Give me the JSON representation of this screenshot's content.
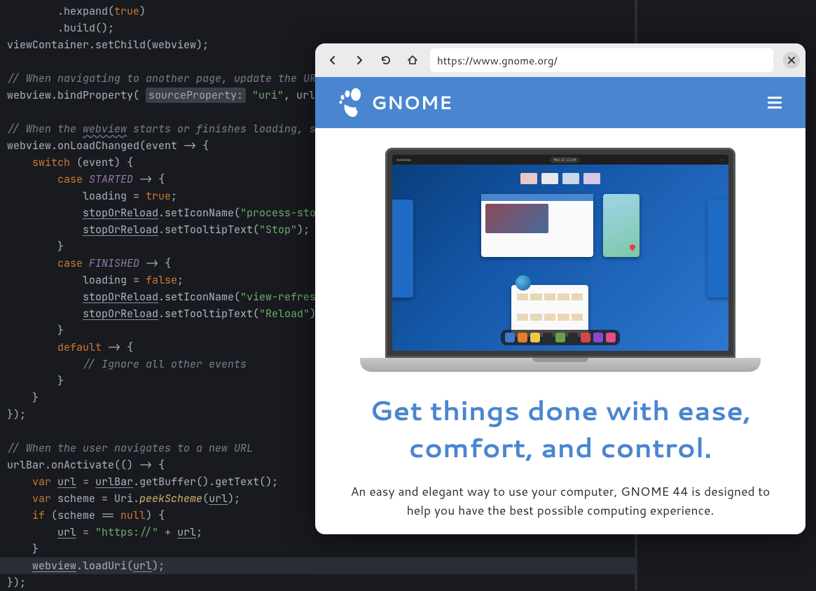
{
  "code": {
    "l1": "        .hexpand(",
    "l1k": "true",
    "l1e": ")",
    "l2": "        .build();",
    "l3": "viewContainer.setChild(webview);",
    "c1": "// When navigating to another page, update the URL bar",
    "l5a": "webview.bindProperty( ",
    "l5param": "sourceProperty:",
    "l5b": " ",
    "l5s": "\"uri\"",
    "l5c": ", urlBar.getBuf",
    "c2": "// When the ",
    "c2u": "webview",
    "c2b": " starts or finishes loading, switch",
    "l8": "webview.onLoadChanged(event -> {",
    "l9a": "    ",
    "kw_switch": "switch",
    "l9b": " (event) {",
    "kw_case": "case",
    "en_started": "STARTED",
    "arrow": " -> {",
    "l11": "            loading = ",
    "true": "true",
    "semi": ";",
    "stopOrReload": "stopOrReload",
    "setIcon": ".setIconName(",
    "s_process": "\"process-stop-symb",
    "setTip": ".setTooltipText(",
    "s_stop": "\"Stop\"",
    "l14e": ");",
    "brace_close": "        }",
    "en_finished": "FINISHED",
    "false": "false",
    "s_refresh": "\"view-refresh-symb",
    "s_reload": "\"Reload\"",
    "kw_default": "default",
    "l22": " -> {",
    "c3": "            // Ignore all other events",
    "l25": "    }",
    "l26": "});",
    "c4": "// When the user navigates to a new URL",
    "l28": "urlBar.onActivate(() -> {",
    "kw_var": "var",
    "l29a": " ",
    "url": "url",
    "l29b": " = ",
    "urlBar": "urlBar",
    "l29c": ".getBuffer().getText();",
    "l30a": " scheme = Uri.",
    "peek": "peekScheme",
    "l30b": "(",
    "l30c": ");",
    "kw_if": "if",
    "l31a": " (scheme == ",
    "null": "null",
    "l31b": ") {",
    "l32a": " = ",
    "s_https": "\"https://\"",
    "l32b": " + ",
    "l33": "    }",
    "l34a": ".loadUri(",
    "webview": "webview"
  },
  "browser": {
    "url": "https://www.gnome.org/"
  },
  "page": {
    "brand": "GNOME",
    "headline": "Get things done with ease, comfort, and control.",
    "subhead": "An easy and elegant way to use your computer, GNOME 44 is designed to help you have the best possible computing experience.",
    "topbar_left": "Activities",
    "topbar_center": "Mar 21 12:34"
  },
  "dock_colors": [
    "#3b7bc8",
    "#e87d2c",
    "#f2c744",
    "#2c2c2c",
    "#6b9e4a",
    "#2c2c2c",
    "#d84545",
    "#8a4ac8",
    "#e84a8a"
  ],
  "thumb_colors": [
    "#e8c8c8",
    "#e8e8e8",
    "#c8d8e8",
    "#d8c8e8"
  ]
}
